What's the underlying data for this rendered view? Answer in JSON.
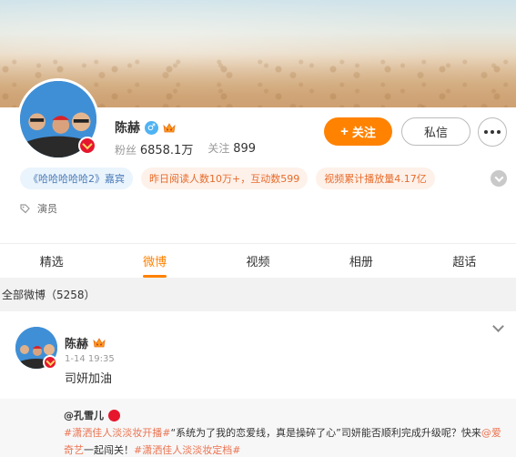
{
  "profile": {
    "name": "陈赫",
    "gender_symbol": "♂",
    "fans_label": "粉丝",
    "fans_value": "6858.1万",
    "following_label": "关注",
    "following_value": "899",
    "follow_button": "关注",
    "message_button": "私信",
    "role": "演员"
  },
  "tags": [
    "《哈哈哈哈哈2》嘉宾",
    "昨日阅读人数10万+，互动数599",
    "视频累计播放量4.17亿"
  ],
  "tabs": [
    "精选",
    "微博",
    "视频",
    "相册",
    "超话"
  ],
  "active_tab": "微博",
  "section": {
    "label": "全部微博（5258）"
  },
  "post": {
    "name": "陈赫",
    "time": "1-14 19:35",
    "text": "司妍加油",
    "repost": {
      "user": "@孔雪儿",
      "text_parts": {
        "hashtag1": "#潇洒佳人淡淡妆开播#",
        "body1": "“系统为了我的恋爱线，真是操碎了心”司妍能否顺利完成升级呢？快来",
        "mention": "@爱奇艺",
        "body2": "一起闯关！",
        "hashtag2": "#潇洒佳人淡淡妆定档#"
      }
    }
  },
  "colors": {
    "accent": "#ff8200",
    "link": "#eb7350",
    "tag_blue_text": "#4a7ab8",
    "tag_orange_text": "#e86b2a",
    "verified": "#e6162d"
  }
}
